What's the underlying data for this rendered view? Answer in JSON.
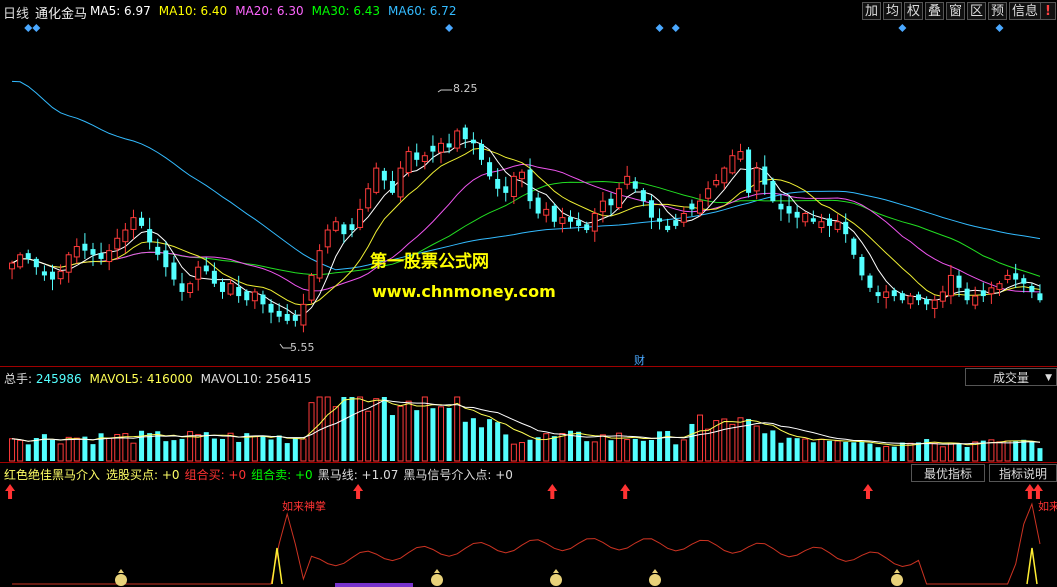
{
  "header": {
    "period": "日线",
    "stock": "通化金马",
    "ma": [
      {
        "label": "MA5: 6.97",
        "color": "#ffffff"
      },
      {
        "label": "MA10: 6.40",
        "color": "#ffff00"
      },
      {
        "label": "MA20: 6.30",
        "color": "#ff66ff"
      },
      {
        "label": "MA30: 6.43",
        "color": "#00ff00"
      },
      {
        "label": "MA60: 6.72",
        "color": "#33bbff"
      }
    ],
    "toolbar": [
      "加",
      "均",
      "权",
      "叠",
      "窗",
      "区",
      "预",
      "信息"
    ]
  },
  "price_panel": {
    "watermark_title": "第一股票公式网",
    "watermark_url": "www.chnmoney.com",
    "high_label": "8.25",
    "low_label": "5.55",
    "fin_marker": "财"
  },
  "volume_panel": {
    "total_label": "总手: ",
    "total_value": "245986",
    "mavol5": "MAVOL5: 416000",
    "mavol10": "MAVOL10: 256415",
    "selector": "成交量"
  },
  "indicator_panel": {
    "name": "红色绝佳黑马介入",
    "items": [
      {
        "label": "选股买点: +0",
        "color": "#ffff66"
      },
      {
        "label": "组合买: +0",
        "color": "#ff3333"
      },
      {
        "label": "组合卖: +0",
        "color": "#00ff00"
      },
      {
        "label": "黑马线: +1.07",
        "color": "#dddddd"
      },
      {
        "label": "黑马信号介入点: +0",
        "color": "#dddddd"
      }
    ],
    "btn_best": "最优指标",
    "btn_help": "指标说明",
    "annotation1": "如来神掌",
    "annotation2": "如来"
  },
  "colors": {
    "up": "#ff3b3b",
    "down": "#54ffff",
    "grid": "#a00000"
  },
  "chart_data": {
    "type": "candlestick",
    "n": 128,
    "price_range": [
      5.3,
      9.2
    ],
    "y_labels_shown": [
      "8.25",
      "5.55"
    ],
    "closes": [
      6.45,
      6.55,
      6.5,
      6.4,
      6.3,
      6.25,
      6.35,
      6.55,
      6.65,
      6.6,
      6.55,
      6.5,
      6.6,
      6.75,
      6.85,
      7.0,
      6.9,
      6.7,
      6.55,
      6.4,
      6.25,
      6.1,
      6.2,
      6.4,
      6.35,
      6.2,
      6.1,
      6.2,
      6.05,
      6.0,
      6.1,
      5.95,
      5.85,
      5.8,
      5.75,
      5.75,
      5.95,
      6.3,
      6.6,
      6.85,
      6.95,
      6.8,
      6.85,
      7.1,
      7.35,
      7.6,
      7.45,
      7.3,
      7.6,
      7.8,
      7.7,
      7.75,
      7.8,
      7.9,
      7.85,
      8.05,
      7.95,
      7.9,
      7.7,
      7.5,
      7.35,
      7.3,
      7.5,
      7.55,
      7.2,
      7.05,
      7.1,
      6.95,
      7.0,
      6.95,
      6.9,
      6.85,
      7.05,
      7.2,
      7.15,
      7.35,
      7.5,
      7.35,
      7.2,
      7.0,
      6.95,
      6.85,
      6.9,
      7.05,
      7.1,
      7.2,
      7.35,
      7.45,
      7.6,
      7.75,
      7.8,
      7.3,
      7.6,
      7.4,
      7.2,
      7.1,
      7.05,
      7.0,
      7.05,
      6.95,
      6.95,
      6.9,
      6.95,
      6.8,
      6.55,
      6.3,
      6.15,
      6.05,
      6.1,
      6.05,
      6.0,
      6.05,
      6.0,
      5.95,
      6.0,
      6.1,
      6.3,
      6.15,
      6.0,
      6.05,
      6.05,
      6.15,
      6.2,
      6.3,
      6.25,
      6.2,
      6.1,
      6.0
    ],
    "extremes": {
      "high": 8.25,
      "low": 5.55
    },
    "volume_max_label": "",
    "indicator_signal_positions": [
      0,
      43,
      67,
      76,
      106,
      126,
      127
    ]
  }
}
